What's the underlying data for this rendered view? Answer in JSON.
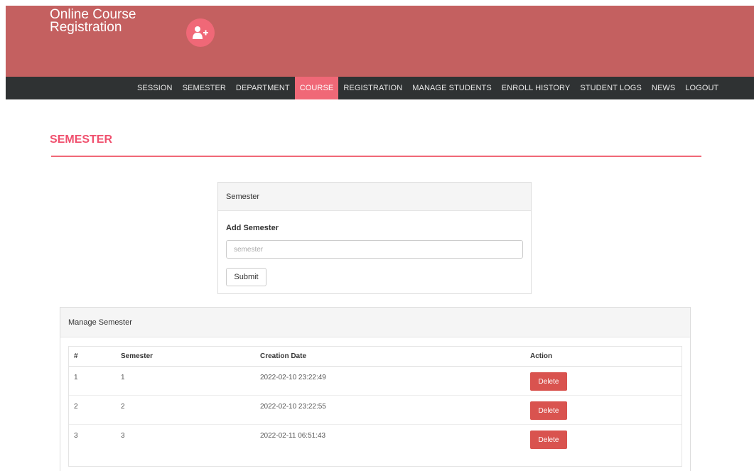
{
  "header": {
    "brand_line1": "Online Course",
    "brand_line2": "Registration",
    "logo_icon": "add-user-icon"
  },
  "nav": {
    "items": [
      {
        "label": "SESSION"
      },
      {
        "label": "SEMESTER"
      },
      {
        "label": "DEPARTMENT"
      },
      {
        "label": "COURSE",
        "active": true
      },
      {
        "label": "REGISTRATION"
      },
      {
        "label": "MANAGE STUDENTS"
      },
      {
        "label": "ENROLL HISTORY"
      },
      {
        "label": "STUDENT LOGS"
      },
      {
        "label": "NEWS"
      },
      {
        "label": "LOGOUT"
      }
    ]
  },
  "page": {
    "title": "SEMESTER"
  },
  "form_panel": {
    "heading": "Semester",
    "label": "Add Semester",
    "input_placeholder": "semester",
    "input_value": "",
    "submit_label": "Submit"
  },
  "manage_panel": {
    "heading": "Manage Semester",
    "columns": [
      "#",
      "Semester",
      "Creation Date",
      "Action"
    ],
    "rows": [
      {
        "num": "1",
        "semester": "1",
        "created": "2022-02-10 23:22:49",
        "action": "Delete"
      },
      {
        "num": "2",
        "semester": "2",
        "created": "2022-02-10 23:22:55",
        "action": "Delete"
      },
      {
        "num": "3",
        "semester": "3",
        "created": "2022-02-11 06:51:43",
        "action": "Delete"
      }
    ]
  },
  "colors": {
    "header_bg": "#c46060",
    "nav_bg": "#2f3233",
    "accent": "#f06877",
    "title": "#f0506e",
    "delete": "#d9534f"
  }
}
